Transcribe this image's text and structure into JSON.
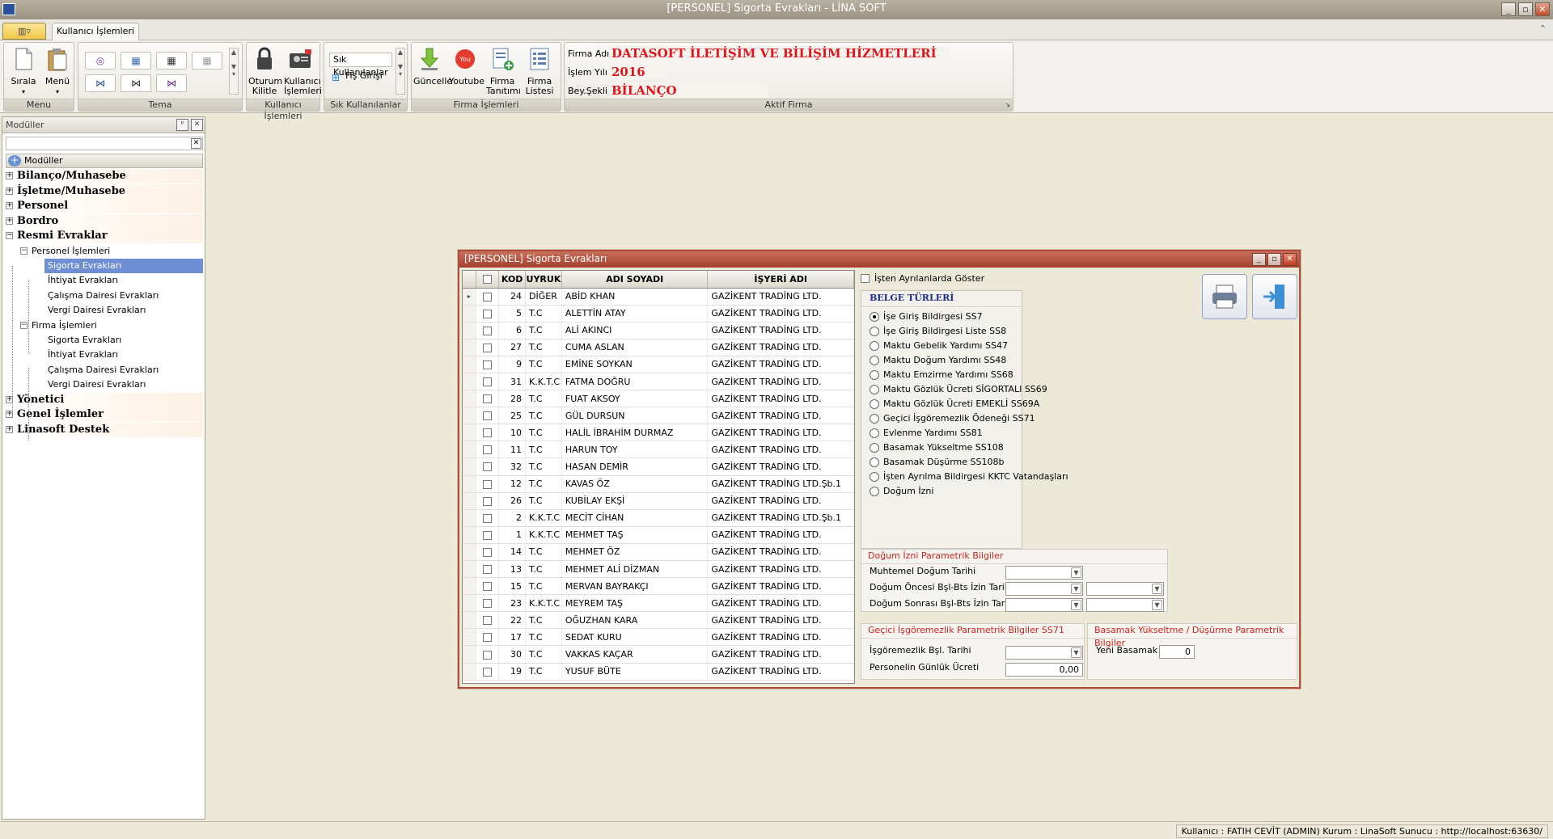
{
  "window": {
    "title": "[PERSONEL] Sigorta Evrakları - LİNA SOFT"
  },
  "ribbon": {
    "tab": "Kullanıcı İşlemleri",
    "groups": {
      "menu": {
        "label": "Menu",
        "buttons": [
          "Sırala",
          "Menü"
        ]
      },
      "tema": {
        "label": "Tema"
      },
      "kullanici": {
        "label": "Kullanıcı İşlemleri",
        "buttons": [
          "Oturum Kilitle",
          "Kullanıcı İşlemleri"
        ]
      },
      "sik": {
        "label": "Sık Kullanılanlar",
        "items": [
          "Sık Kullanılanlar",
          "Fiş Girişi"
        ]
      },
      "firma": {
        "label": "Firma İşlemleri",
        "buttons": [
          "Güncelle",
          "Youtube",
          "Firma Tanıtımı",
          "Firma Listesi"
        ]
      },
      "aktif": {
        "label": "Aktif Firma"
      }
    },
    "aktif_firma": {
      "firma_adi_label": "Firma Adı",
      "firma_adi": "DATASOFT İLETİŞİM VE BİLİŞİM HİZMETLERİ",
      "islem_yili_label": "İşlem Yılı",
      "islem_yili": "2016",
      "bey_sekli_label": "Bey.Şekli",
      "bey_sekli": "BİLANÇO"
    }
  },
  "modules": {
    "header": "Modüller",
    "root": "Modüller",
    "tree": [
      {
        "label": "Bilanço/Muhasebe",
        "level": 0,
        "exp": "+"
      },
      {
        "label": "İşletme/Muhasebe",
        "level": 0,
        "exp": "+"
      },
      {
        "label": "Personel",
        "level": 0,
        "exp": "+"
      },
      {
        "label": "Bordro",
        "level": 0,
        "exp": "+"
      },
      {
        "label": "Resmi Evraklar",
        "level": 0,
        "exp": "−"
      },
      {
        "label": "Personel İşlemleri",
        "level": 1,
        "exp": "−"
      },
      {
        "label": "Sigorta Evrakları",
        "level": 2,
        "selected": true
      },
      {
        "label": "İhtiyat Evrakları",
        "level": 2
      },
      {
        "label": "Çalışma Dairesi Evrakları",
        "level": 2
      },
      {
        "label": "Vergi Dairesi Evrakları",
        "level": 2
      },
      {
        "label": "Firma İşlemleri",
        "level": 1,
        "exp": "−"
      },
      {
        "label": "Sigorta Evrakları",
        "level": 2
      },
      {
        "label": "İhtiyat Evrakları",
        "level": 2
      },
      {
        "label": "Çalışma Dairesi Evrakları",
        "level": 2
      },
      {
        "label": "Vergi Dairesi Evrakları",
        "level": 2
      },
      {
        "label": "Yönetici",
        "level": 0,
        "exp": "+"
      },
      {
        "label": "Genel İşlemler",
        "level": 0,
        "exp": "+"
      },
      {
        "label": "Linasoft Destek",
        "level": 0,
        "exp": "+"
      }
    ]
  },
  "dialog": {
    "title": "[PERSONEL] Sigorta Evrakları",
    "columns": [
      "KOD",
      "UYRUK",
      "ADI SOYADI",
      "İŞYERİ ADI"
    ],
    "rows": [
      [
        "24",
        "DİĞER",
        "ABİD KHAN",
        "GAZİKENT TRADİNG LTD."
      ],
      [
        "5",
        "T.C",
        "ALETTİN ATAY",
        "GAZİKENT TRADİNG LTD."
      ],
      [
        "6",
        "T.C",
        "ALİ AKINCI",
        "GAZİKENT TRADİNG LTD."
      ],
      [
        "27",
        "T.C",
        "CUMA ASLAN",
        "GAZİKENT TRADİNG LTD."
      ],
      [
        "9",
        "T.C",
        "EMİNE SOYKAN",
        "GAZİKENT TRADİNG LTD."
      ],
      [
        "31",
        "K.K.T.C",
        "FATMA DOĞRU",
        "GAZİKENT TRADİNG LTD."
      ],
      [
        "28",
        "T.C",
        "FUAT AKSOY",
        "GAZİKENT TRADİNG LTD."
      ],
      [
        "25",
        "T.C",
        "GÜL DURSUN",
        "GAZİKENT TRADİNG LTD."
      ],
      [
        "10",
        "T.C",
        "HALİL İBRAHİM DURMAZ",
        "GAZİKENT TRADİNG LTD."
      ],
      [
        "11",
        "T.C",
        "HARUN TOY",
        "GAZİKENT TRADİNG LTD."
      ],
      [
        "32",
        "T.C",
        "HASAN DEMİR",
        "GAZİKENT TRADİNG LTD."
      ],
      [
        "12",
        "T.C",
        "KAVAS ÖZ",
        "GAZİKENT TRADİNG LTD.Şb.1"
      ],
      [
        "26",
        "T.C",
        "KUBİLAY EKŞİ",
        "GAZİKENT TRADİNG LTD."
      ],
      [
        "2",
        "K.K.T.C",
        "MECİT CİHAN",
        "GAZİKENT TRADİNG LTD.Şb.1"
      ],
      [
        "1",
        "K.K.T.C",
        "MEHMET TAŞ",
        "GAZİKENT TRADİNG LTD."
      ],
      [
        "14",
        "T.C",
        "MEHMET ÖZ",
        "GAZİKENT TRADİNG LTD."
      ],
      [
        "13",
        "T.C",
        "MEHMET ALİ DİZMAN",
        "GAZİKENT TRADİNG LTD."
      ],
      [
        "15",
        "T.C",
        "MERVAN BAYRAKÇI",
        "GAZİKENT TRADİNG LTD."
      ],
      [
        "23",
        "K.K.T.C",
        "MEYREM TAŞ",
        "GAZİKENT TRADİNG LTD."
      ],
      [
        "22",
        "T.C",
        "OĞUZHAN KARA",
        "GAZİKENT TRADİNG LTD."
      ],
      [
        "17",
        "T.C",
        "SEDAT KURU",
        "GAZİKENT TRADİNG LTD."
      ],
      [
        "30",
        "T.C",
        "VAKKAS KAÇAR",
        "GAZİKENT TRADİNG LTD."
      ],
      [
        "19",
        "T.C",
        "YUSUF BÜTE",
        "GAZİKENT TRADİNG LTD."
      ]
    ],
    "show_left_label": "İşten Ayrılanlarda Göster",
    "belge_title": "BELGE TÜRLERİ",
    "belge_options": [
      "İşe Giriş Bildirgesi SS7",
      "İşe Giriş Bildirgesi Liste SS8",
      "Maktu Gebelik Yardımı SS47",
      "Maktu Doğum Yardımı SS48",
      "Maktu Emzirme Yardımı SS68",
      "Maktu Gözlük Ücreti SİGORTALI SS69",
      "Maktu Gözlük Ücreti EMEKLİ SS69A",
      "Geçici İşgöremezlik Ödeneği SS71",
      "Evlenme Yardımı SS81",
      "Basamak Yükseltme SS108",
      "Basamak Düşürme SS108b",
      "İşten Ayrılma Bildirgesi KKTC Vatandaşları",
      "Doğum İzni"
    ],
    "belge_selected": 0,
    "dogum": {
      "title": "Doğum İzni Parametrik Bilgiler",
      "muhtemel": "Muhtemel Doğum Tarihi",
      "oncesi": "Doğum Öncesi Bşl-Bts İzin Tarihi",
      "sonrasi": "Doğum Sonrası Bşl-Bts İzin Tarihi"
    },
    "gecici": {
      "title": "Geçici İşgöremezlik Parametrik Bilgiler SS71",
      "bsl": "İşgöremezlik Bşl. Tarihi",
      "ucret_label": "Personelin Günlük Ücreti",
      "ucret": "0,00"
    },
    "basamak": {
      "title": "Basamak Yükseltme / Düşürme Parametrik Bilgiler",
      "label": "Yeni Basamak",
      "value": "0"
    }
  },
  "status": {
    "text": "Kullanıcı : FATIH CEVİT (ADMIN)  Kurum : LinaSoft  Sunucu : http://localhost:63630/"
  }
}
